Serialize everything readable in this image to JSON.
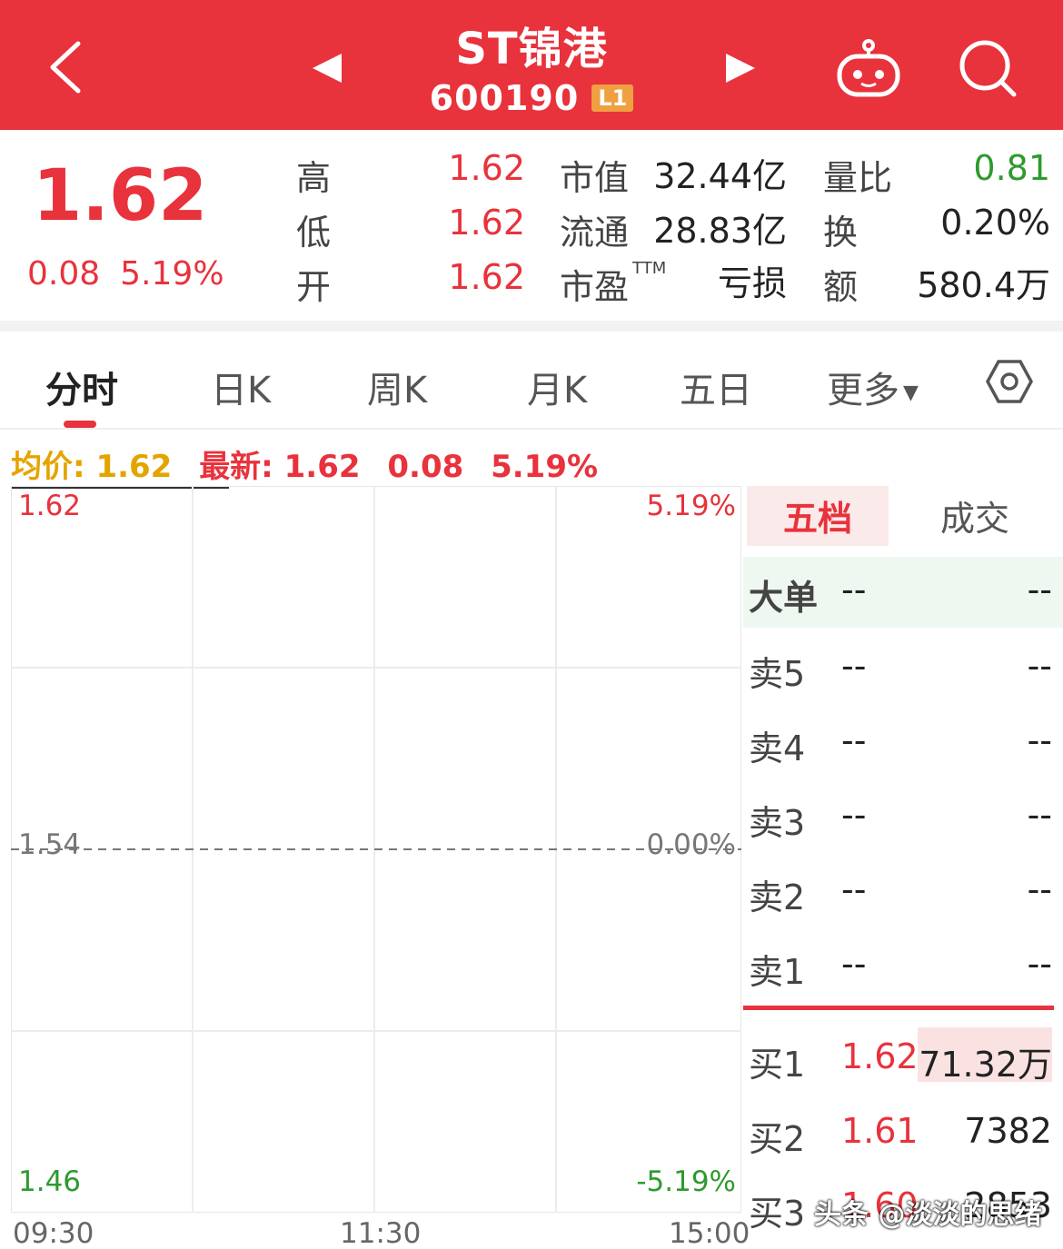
{
  "header": {
    "title": "ST锦港",
    "code": "600190",
    "level": "L1"
  },
  "quote": {
    "price": "1.62",
    "change": "0.08",
    "change_pct": "5.19%",
    "high_label": "高",
    "high": "1.62",
    "low_label": "低",
    "low": "1.62",
    "open_label": "开",
    "open": "1.62",
    "mcap_label": "市值",
    "mcap": "32.44亿",
    "float_label": "流通",
    "float": "28.83亿",
    "pe_label": "市盈",
    "pe_suffix": "TTM",
    "pe": "亏损",
    "vol_ratio_label": "量比",
    "vol_ratio": "0.81",
    "turnover_label": "换",
    "turnover": "0.20%",
    "amount_label": "额",
    "amount": "580.4万"
  },
  "tabs": {
    "intraday": "分时",
    "daily": "日K",
    "weekly": "周K",
    "monthly": "月K",
    "five_day": "五日",
    "more": "更多"
  },
  "info": {
    "avg_label": "均价:",
    "avg": "1.62",
    "latest_label": "最新:",
    "latest": "1.62",
    "change": "0.08",
    "change_pct": "5.19%"
  },
  "chart_data": {
    "type": "line",
    "y_labels_left": [
      "1.62",
      "1.54",
      "1.46"
    ],
    "y_labels_right": [
      "5.19%",
      "0.00%",
      "-5.19%"
    ],
    "x_labels": [
      "09:30",
      "11:30",
      "15:00"
    ],
    "ylim": [
      1.46,
      1.62
    ],
    "series": []
  },
  "book": {
    "tab_five": "五档",
    "tab_trades": "成交",
    "big_order_label": "大单",
    "big_order_price": "--",
    "big_order_vol": "--",
    "sells": [
      {
        "label": "卖5",
        "price": "--",
        "vol": "--"
      },
      {
        "label": "卖4",
        "price": "--",
        "vol": "--"
      },
      {
        "label": "卖3",
        "price": "--",
        "vol": "--"
      },
      {
        "label": "卖2",
        "price": "--",
        "vol": "--"
      },
      {
        "label": "卖1",
        "price": "--",
        "vol": "--"
      }
    ],
    "buys": [
      {
        "label": "买1",
        "price": "1.62",
        "vol": "71.32万"
      },
      {
        "label": "买2",
        "price": "1.61",
        "vol": "7382"
      },
      {
        "label": "买3",
        "price": "1.60",
        "vol": "2853"
      }
    ]
  },
  "watermark": "头条 @淡淡的思绪",
  "colors": {
    "header_bg": "#e8323c",
    "up": "#e8323c",
    "down": "#2e9a2e",
    "avg": "#e4a400"
  }
}
